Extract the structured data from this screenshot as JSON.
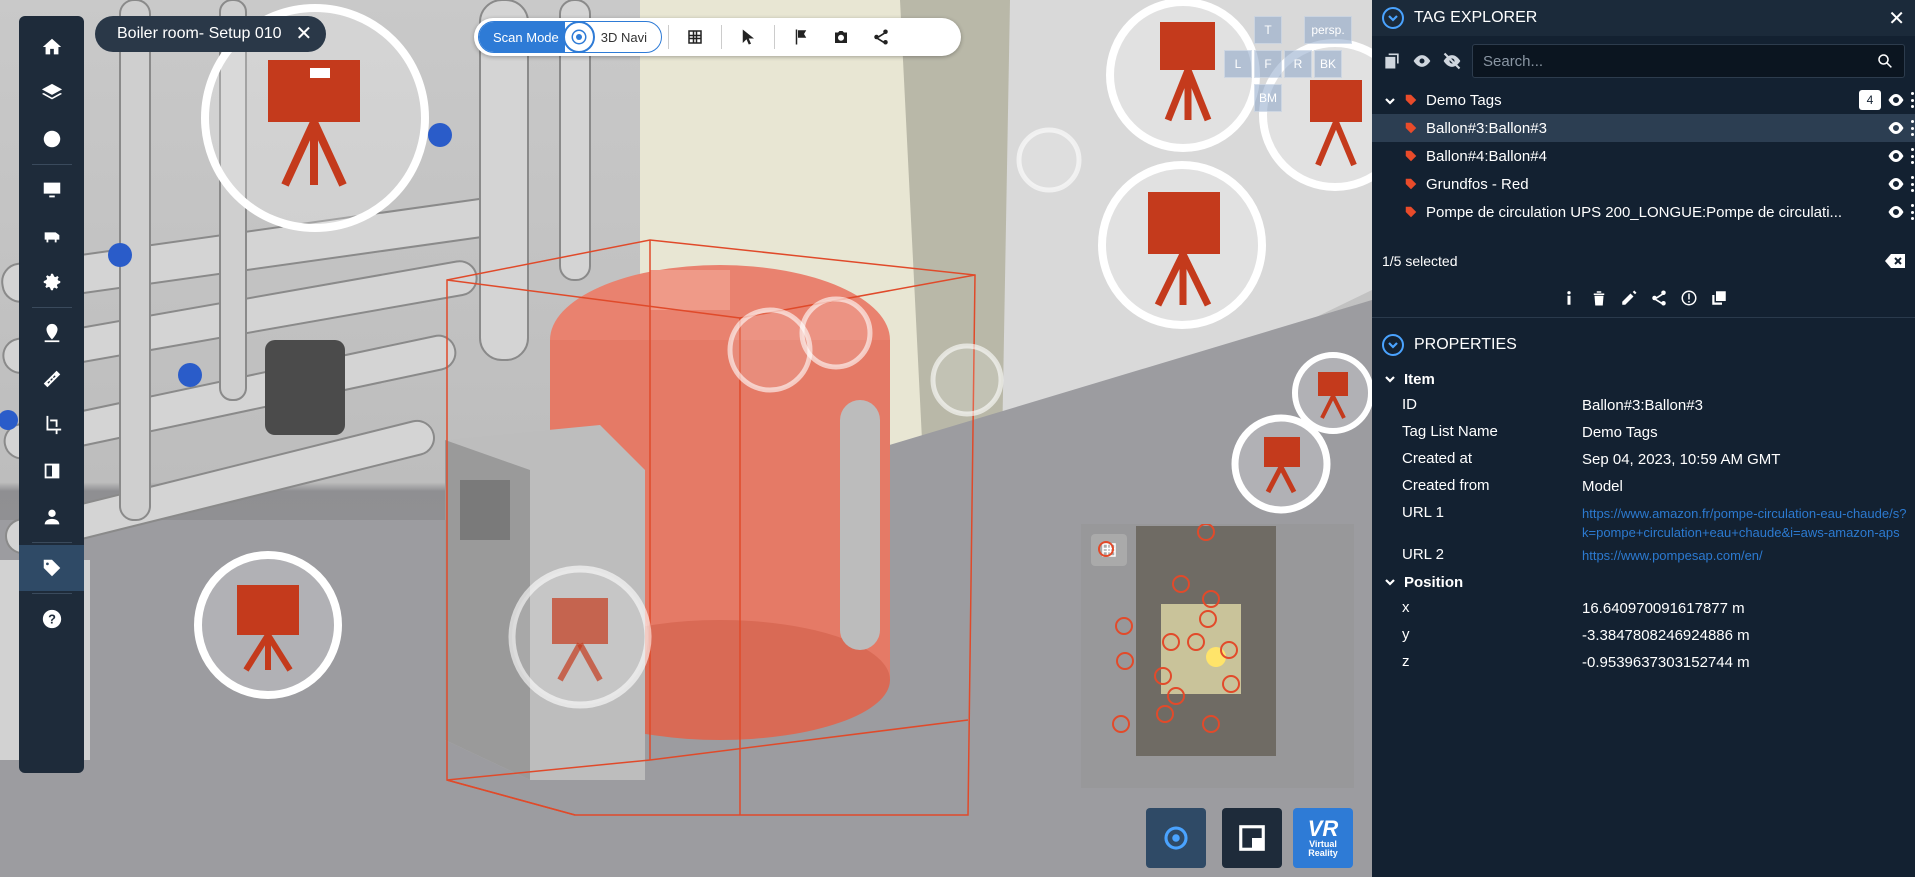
{
  "left_toolbar": {
    "items": [
      {
        "name": "home-icon"
      },
      {
        "name": "layers-icon"
      },
      {
        "name": "sphere-icon"
      },
      {
        "name": "monitor-icon"
      },
      {
        "name": "cattle-icon"
      },
      {
        "name": "gear-icon"
      },
      {
        "name": "location-pin-icon"
      },
      {
        "name": "ruler-icon"
      },
      {
        "name": "crop-icon"
      },
      {
        "name": "clip-box-icon"
      },
      {
        "name": "globe-user-icon"
      },
      {
        "name": "tag-icon"
      },
      {
        "name": "help-icon"
      }
    ]
  },
  "scene_chip": {
    "title": "Boiler room- Setup 010",
    "close": "✕"
  },
  "top_toolbar": {
    "scan_mode": "Scan Mode",
    "navi_mode": "3D Navi"
  },
  "view_cube": {
    "top": "T",
    "persp": "persp.",
    "left": "L",
    "front": "F",
    "right": "R",
    "back": "BK",
    "bottom": "BM"
  },
  "vr_button": {
    "title": "VR",
    "line1": "Virtual",
    "line2": "Reality"
  },
  "tag_explorer": {
    "title": "TAG EXPLORER",
    "close": "✕",
    "search_placeholder": "Search...",
    "group": {
      "label": "Demo Tags",
      "count": "4"
    },
    "tags": [
      {
        "label": "Ballon#3:Ballon#3",
        "selected": true
      },
      {
        "label": "Ballon#4:Ballon#4",
        "selected": false
      },
      {
        "label": "Grundfos - Red",
        "selected": false
      },
      {
        "label": "Pompe de circulation UPS 200_LONGUE:Pompe de circulati...",
        "selected": false
      }
    ],
    "selection_status": "1/5 selected"
  },
  "properties": {
    "title": "PROPERTIES",
    "item_section": "Item",
    "position_section": "Position",
    "item": [
      {
        "key": "ID",
        "value": "Ballon#3:Ballon#3"
      },
      {
        "key": "Tag List Name",
        "value": "Demo Tags"
      },
      {
        "key": "Created at",
        "value": "Sep 04, 2023, 10:59 AM GMT"
      },
      {
        "key": "Created from",
        "value": "Model"
      }
    ],
    "url1_key": "URL 1",
    "url1_value": "https://www.amazon.fr/pompe-circulation-eau-chaude/s?k=pompe+circulation+eau+chaude&i=aws-amazon-aps",
    "url2_key": "URL 2",
    "url2_value": "https://www.pompesap.com/en/",
    "position": [
      {
        "key": "x",
        "value": "16.640970091617877 m"
      },
      {
        "key": "y",
        "value": "-3.3847808246924886 m"
      },
      {
        "key": "z",
        "value": "-0.9539637303152744 m"
      }
    ]
  },
  "colors": {
    "accent": "#2e7bd6",
    "tag_red": "#e94b2a",
    "panel_bg": "#132131",
    "scanner_red": "#c43a1c"
  }
}
